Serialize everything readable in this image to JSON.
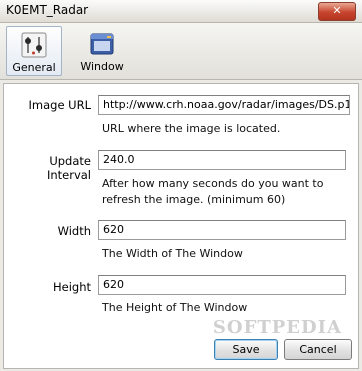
{
  "window": {
    "title": "K0EMT_Radar",
    "close_label": "✕"
  },
  "toolbar": {
    "items": [
      {
        "label": "General",
        "selected": true,
        "icon": "general-settings-icon"
      },
      {
        "label": "Window",
        "selected": false,
        "icon": "window-icon"
      }
    ]
  },
  "form": {
    "image_url": {
      "label": "Image URL",
      "value": "http://www.crh.noaa.gov/radar/images/DS.p1",
      "hint": "URL where the image is located."
    },
    "update_interval": {
      "label": "Update Interval",
      "value": "240.0",
      "hint_line1": "After how many seconds do you want to",
      "hint_line2": "refresh the image. (minimum 60)"
    },
    "width": {
      "label": "Width",
      "value": "620",
      "hint": "The Width of The Window"
    },
    "height": {
      "label": "Height",
      "value": "620",
      "hint": "The Height of The Window"
    }
  },
  "buttons": {
    "save": "Save",
    "cancel": "Cancel"
  },
  "watermark": "SOFTPEDIA",
  "colors": {
    "selected_tab_border": "#a5b3c6",
    "default_button_border": "#3c7fb1",
    "close_button": "#c7442d"
  }
}
